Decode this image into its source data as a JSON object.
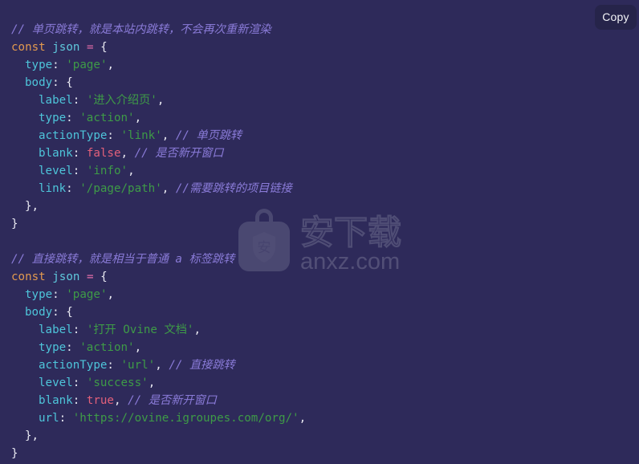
{
  "theme": {
    "background": "#2e2a5a",
    "keyword": "#e2994f",
    "variable": "#5fc9dd",
    "operator": "#e06ca8",
    "punctuation": "#e9e9f2",
    "key": "#4ec5da",
    "string": "#3e9b47",
    "boolean": "#e2607a",
    "comment": "#8a7bd8",
    "copy_button_background": "#26244a",
    "copy_button_text": "#f2f3f7"
  },
  "toolbar": {
    "copy_label": "Copy"
  },
  "watermark": {
    "logo_char": "安",
    "title": "安下载",
    "domain": "anxz.com"
  },
  "code": {
    "language": "javascript",
    "blocks": [
      {
        "comment": "// 单页跳转，就是本站内跳转，不会再次重新渲染",
        "declaration": "const json = {",
        "entries": [
          {
            "key": "type",
            "value": "'page'",
            "value_type": "string"
          },
          {
            "key": "body",
            "value": "{",
            "value_type": "object"
          },
          {
            "key": "label",
            "value": "'进入介绍页'",
            "value_type": "string"
          },
          {
            "key": "type",
            "value": "'action'",
            "value_type": "string"
          },
          {
            "key": "actionType",
            "value": "'link'",
            "value_type": "string",
            "comment": "// 单页跳转"
          },
          {
            "key": "blank",
            "value": "false",
            "value_type": "boolean",
            "comment": "// 是否新开窗口"
          },
          {
            "key": "level",
            "value": "'info'",
            "value_type": "string"
          },
          {
            "key": "link",
            "value": "'/page/path'",
            "value_type": "string",
            "comment": "//需要跳转的项目链接"
          }
        ]
      },
      {
        "comment": "// 直接跳转，就是相当于普通 a 标签跳转",
        "declaration": "const json = {",
        "entries": [
          {
            "key": "type",
            "value": "'page'",
            "value_type": "string"
          },
          {
            "key": "body",
            "value": "{",
            "value_type": "object"
          },
          {
            "key": "label",
            "value": "'打开 Ovine 文档'",
            "value_type": "string"
          },
          {
            "key": "type",
            "value": "'action'",
            "value_type": "string"
          },
          {
            "key": "actionType",
            "value": "'url'",
            "value_type": "string",
            "comment": "// 直接跳转"
          },
          {
            "key": "level",
            "value": "'success'",
            "value_type": "string"
          },
          {
            "key": "blank",
            "value": "true",
            "value_type": "boolean",
            "comment": "// 是否新开窗口"
          },
          {
            "key": "url",
            "value": "'https://ovine.igroupes.com/org/'",
            "value_type": "string"
          }
        ]
      }
    ],
    "lines": [
      {
        "indent": 0,
        "tokens": [
          {
            "t": "comment",
            "s": "// 单页跳转，就是本站内跳转，不会再次重新渲染"
          }
        ]
      },
      {
        "indent": 0,
        "tokens": [
          {
            "t": "kw",
            "s": "const"
          },
          {
            "t": "punc",
            "s": " "
          },
          {
            "t": "var",
            "s": "json"
          },
          {
            "t": "punc",
            "s": " "
          },
          {
            "t": "op",
            "s": "="
          },
          {
            "t": "punc",
            "s": " {"
          }
        ]
      },
      {
        "indent": 1,
        "tokens": [
          {
            "t": "key",
            "s": "type"
          },
          {
            "t": "punc",
            "s": ": "
          },
          {
            "t": "str",
            "s": "'page'"
          },
          {
            "t": "punc",
            "s": ","
          }
        ]
      },
      {
        "indent": 1,
        "tokens": [
          {
            "t": "key",
            "s": "body"
          },
          {
            "t": "punc",
            "s": ": {"
          }
        ]
      },
      {
        "indent": 2,
        "tokens": [
          {
            "t": "key",
            "s": "label"
          },
          {
            "t": "punc",
            "s": ": "
          },
          {
            "t": "str",
            "s": "'进入介绍页'"
          },
          {
            "t": "punc",
            "s": ","
          }
        ]
      },
      {
        "indent": 2,
        "tokens": [
          {
            "t": "key",
            "s": "type"
          },
          {
            "t": "punc",
            "s": ": "
          },
          {
            "t": "str",
            "s": "'action'"
          },
          {
            "t": "punc",
            "s": ","
          }
        ]
      },
      {
        "indent": 2,
        "tokens": [
          {
            "t": "key",
            "s": "actionType"
          },
          {
            "t": "punc",
            "s": ": "
          },
          {
            "t": "str",
            "s": "'link'"
          },
          {
            "t": "punc",
            "s": ", "
          },
          {
            "t": "comment",
            "s": "// 单页跳转"
          }
        ]
      },
      {
        "indent": 2,
        "tokens": [
          {
            "t": "key",
            "s": "blank"
          },
          {
            "t": "punc",
            "s": ": "
          },
          {
            "t": "bool",
            "s": "false"
          },
          {
            "t": "punc",
            "s": ", "
          },
          {
            "t": "comment",
            "s": "// 是否新开窗口"
          }
        ]
      },
      {
        "indent": 2,
        "tokens": [
          {
            "t": "key",
            "s": "level"
          },
          {
            "t": "punc",
            "s": ": "
          },
          {
            "t": "str",
            "s": "'info'"
          },
          {
            "t": "punc",
            "s": ","
          }
        ]
      },
      {
        "indent": 2,
        "tokens": [
          {
            "t": "key",
            "s": "link"
          },
          {
            "t": "punc",
            "s": ": "
          },
          {
            "t": "str",
            "s": "'/page/path'"
          },
          {
            "t": "punc",
            "s": ", "
          },
          {
            "t": "comment",
            "s": "//需要跳转的项目链接"
          }
        ]
      },
      {
        "indent": 1,
        "tokens": [
          {
            "t": "punc",
            "s": "},"
          }
        ]
      },
      {
        "indent": 0,
        "tokens": [
          {
            "t": "punc",
            "s": "}"
          }
        ]
      },
      {
        "indent": 0,
        "tokens": []
      },
      {
        "indent": 0,
        "tokens": [
          {
            "t": "comment",
            "s": "// 直接跳转，就是相当于普通 a 标签跳转"
          }
        ]
      },
      {
        "indent": 0,
        "tokens": [
          {
            "t": "kw",
            "s": "const"
          },
          {
            "t": "punc",
            "s": " "
          },
          {
            "t": "var",
            "s": "json"
          },
          {
            "t": "punc",
            "s": " "
          },
          {
            "t": "op",
            "s": "="
          },
          {
            "t": "punc",
            "s": " {"
          }
        ]
      },
      {
        "indent": 1,
        "tokens": [
          {
            "t": "key",
            "s": "type"
          },
          {
            "t": "punc",
            "s": ": "
          },
          {
            "t": "str",
            "s": "'page'"
          },
          {
            "t": "punc",
            "s": ","
          }
        ]
      },
      {
        "indent": 1,
        "tokens": [
          {
            "t": "key",
            "s": "body"
          },
          {
            "t": "punc",
            "s": ": {"
          }
        ]
      },
      {
        "indent": 2,
        "tokens": [
          {
            "t": "key",
            "s": "label"
          },
          {
            "t": "punc",
            "s": ": "
          },
          {
            "t": "str",
            "s": "'打开 Ovine 文档'"
          },
          {
            "t": "punc",
            "s": ","
          }
        ]
      },
      {
        "indent": 2,
        "tokens": [
          {
            "t": "key",
            "s": "type"
          },
          {
            "t": "punc",
            "s": ": "
          },
          {
            "t": "str",
            "s": "'action'"
          },
          {
            "t": "punc",
            "s": ","
          }
        ]
      },
      {
        "indent": 2,
        "tokens": [
          {
            "t": "key",
            "s": "actionType"
          },
          {
            "t": "punc",
            "s": ": "
          },
          {
            "t": "str",
            "s": "'url'"
          },
          {
            "t": "punc",
            "s": ", "
          },
          {
            "t": "comment",
            "s": "// 直接跳转"
          }
        ]
      },
      {
        "indent": 2,
        "tokens": [
          {
            "t": "key",
            "s": "level"
          },
          {
            "t": "punc",
            "s": ": "
          },
          {
            "t": "str",
            "s": "'success'"
          },
          {
            "t": "punc",
            "s": ","
          }
        ]
      },
      {
        "indent": 2,
        "tokens": [
          {
            "t": "key",
            "s": "blank"
          },
          {
            "t": "punc",
            "s": ": "
          },
          {
            "t": "bool",
            "s": "true"
          },
          {
            "t": "punc",
            "s": ", "
          },
          {
            "t": "comment",
            "s": "// 是否新开窗口"
          }
        ]
      },
      {
        "indent": 2,
        "tokens": [
          {
            "t": "key",
            "s": "url"
          },
          {
            "t": "punc",
            "s": ": "
          },
          {
            "t": "str",
            "s": "'https://ovine.igroupes.com/org/'"
          },
          {
            "t": "punc",
            "s": ","
          }
        ]
      },
      {
        "indent": 1,
        "tokens": [
          {
            "t": "punc",
            "s": "},"
          }
        ]
      },
      {
        "indent": 0,
        "tokens": [
          {
            "t": "punc",
            "s": "}"
          }
        ]
      }
    ]
  }
}
